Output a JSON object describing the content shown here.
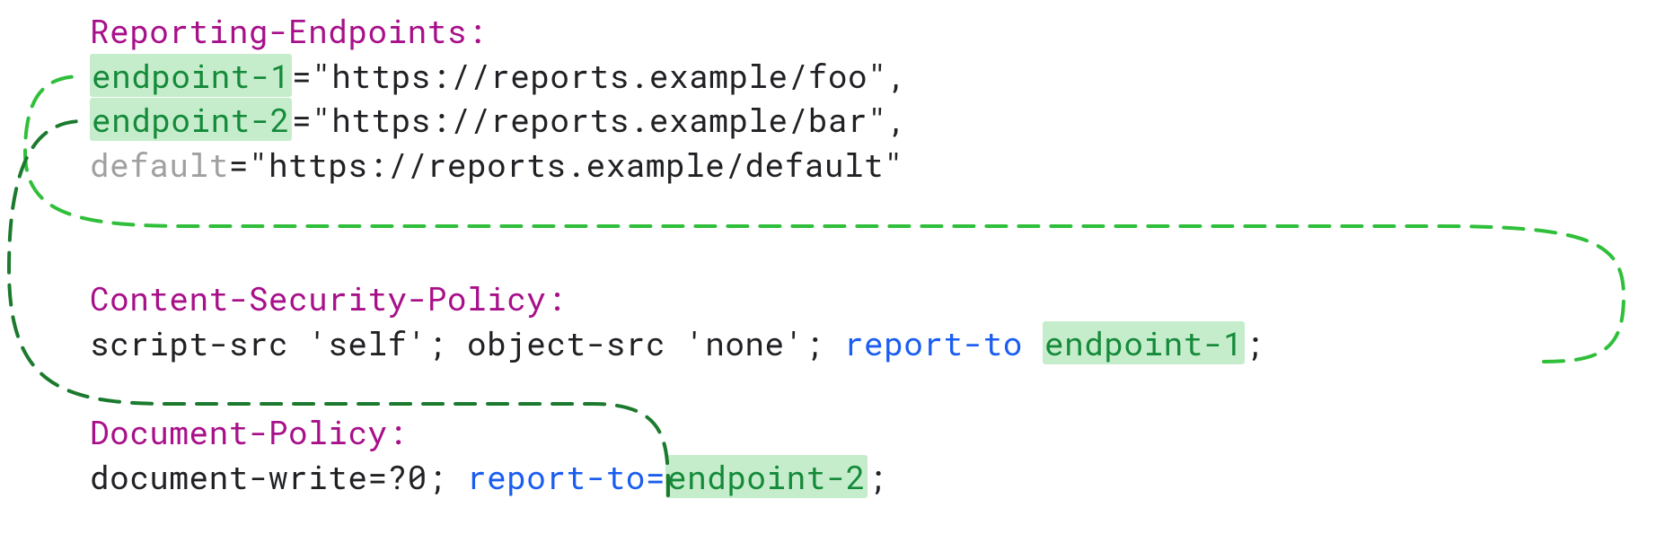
{
  "headers": {
    "reporting_endpoints": {
      "name": "Reporting-Endpoints:",
      "endpoints": [
        {
          "key": "endpoint-1",
          "value": "\"https://reports.example/foo\"",
          "trailing_comma": true,
          "faded": false
        },
        {
          "key": "endpoint-2",
          "value": "\"https://reports.example/bar\"",
          "trailing_comma": true,
          "faded": false
        },
        {
          "key": "default",
          "value": "\"https://reports.example/default\"",
          "trailing_comma": false,
          "faded": true
        }
      ]
    },
    "csp": {
      "name": "Content-Security-Policy:",
      "body_prefix": "script-src 'self'; object-src 'none'; ",
      "keyword": "report-to ",
      "target": "endpoint-1",
      "trailing": ";"
    },
    "dp": {
      "name": "Document-Policy:",
      "body_prefix": "document-write=?0; ",
      "keyword": "report-to=",
      "target": "endpoint-2",
      "trailing": ";"
    }
  },
  "diagram": {
    "arrows": [
      {
        "from_header": "Content-Security-Policy",
        "from_token": "endpoint-1",
        "to_header": "Reporting-Endpoints",
        "to_token": "endpoint-1",
        "style": "light-green-dashed"
      },
      {
        "from_header": "Document-Policy",
        "from_token": "endpoint-2",
        "to_header": "Reporting-Endpoints",
        "to_token": "endpoint-2",
        "style": "dark-green-dashed"
      }
    ]
  }
}
